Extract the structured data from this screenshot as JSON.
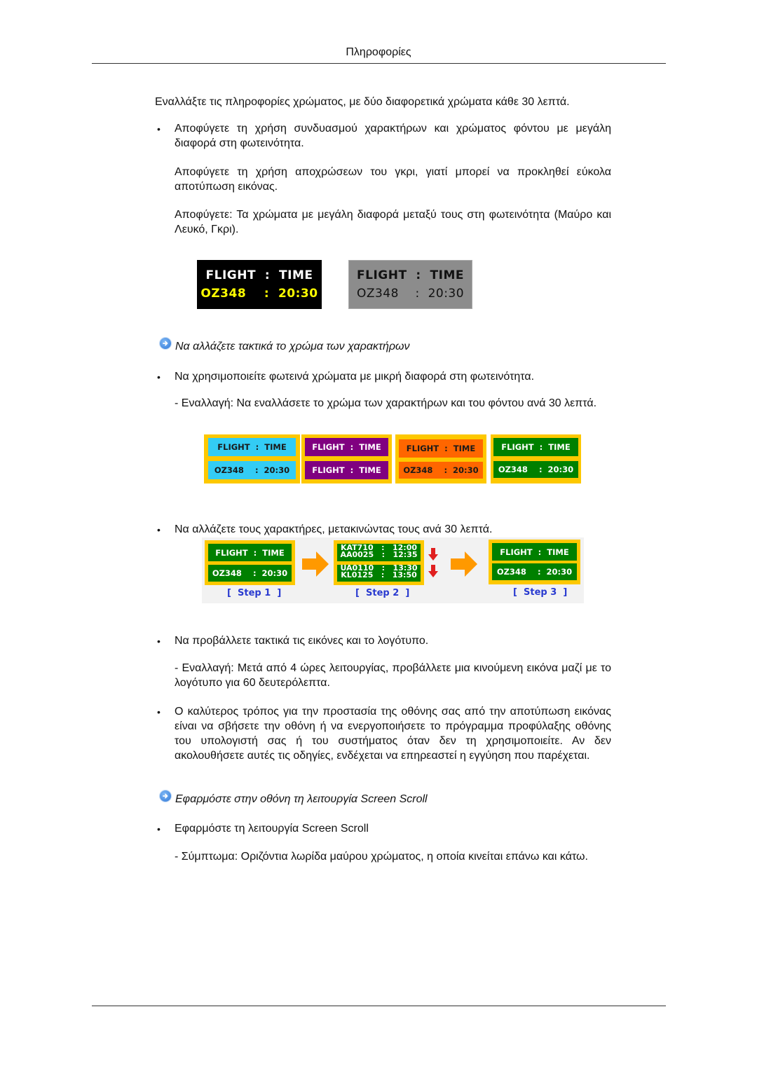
{
  "header": {
    "title": "Πληροφορίες"
  },
  "intro": "Εναλλάξτε τις πληροφορίες χρώματος, με δύο διαφορετικά χρώματα κάθε 30 λεπτά.",
  "section1": {
    "bullet": "Αποφύγετε τη χρήση συνδυασμού χαρακτήρων και χρώματος φόντου με μεγάλη διαφορά στη φωτεινότητα.",
    "para1": "Αποφύγετε τη χρήση αποχρώσεων του γκρι, γιατί μπορεί να προκληθεί εύκολα αποτύπωση εικόνας.",
    "para2": "Αποφύγετε: Τα χρώματα με μεγάλη διαφορά μεταξύ τους στη φωτεινότητα (Μαύρο και Λευκό, Γκρι).",
    "examples": [
      {
        "line1": "FLIGHT  :  TIME",
        "line2": "OZ348    :  20:30",
        "bg": "#000000",
        "color1": "#ffffff",
        "color2": "#ffff00"
      },
      {
        "line1": "FLIGHT  :  TIME",
        "line2": "OZ348    :  20:30",
        "bg": "#8c8c8c",
        "color1": "#111111",
        "color2": "#111111"
      }
    ]
  },
  "section2": {
    "heading": "Να αλλάζετε τακτικά το χρώμα των χαρακτήρων",
    "heading_icon": "arrow-right-circle-icon",
    "bullet": "Να χρησιμοποιείτε φωτεινά χρώματα με μικρή διαφορά στη φωτεινότητα.",
    "para": "- Εναλλαγή: Να εναλλάσετε το χρώμα των χαρακτήρων και του φόντου ανά 30 λεπτά.",
    "frame_color": "#fdc800",
    "panels": [
      {
        "top": "FLIGHT  :  TIME",
        "bottom": "OZ348    :  20:30",
        "bg": "#33ccf5",
        "color": "#1a1a1a"
      },
      {
        "top": "FLIGHT  :  TIME",
        "bottom": "FLIGHT  :  TIME",
        "bg": "#800080",
        "color": "#ffffff"
      },
      {
        "top": "FLIGHT  :  TIME",
        "bottom": "OZ348    :  20:30",
        "bg": "#ff6600",
        "color": "#1a1a1a"
      },
      {
        "top": "FLIGHT  :  TIME",
        "bottom": "OZ348    :  20:30",
        "bg": "#008000",
        "color": "#ffffff"
      }
    ]
  },
  "section3": {
    "bullet": "Να αλλάζετε τους χαρακτήρες, μετακινώντας τους ανά 30 λεπτά.",
    "steps": [
      {
        "label": "[  Step 1  ]",
        "top": "FLIGHT  :  TIME",
        "bottom": "OZ348    :  20:30"
      },
      {
        "label": "[  Step 2  ]",
        "top_a": "KAT710   :   12:00",
        "top_b": "AA0025   :   12:35",
        "bottom_a": "UA0110   :   13:30",
        "bottom_b": "KL0125   :   13:50"
      },
      {
        "label": "[  Step 3  ]",
        "top": "FLIGHT  :  TIME",
        "bottom": "OZ348    :  20:30"
      }
    ],
    "panel_bg": "#008000",
    "text_color": "#ffffff",
    "arrow_color": "#ff9900",
    "down_arrow_color": "#e02020",
    "step_label_color": "#2a3bd0"
  },
  "section4": {
    "bullet": "Να προβάλλετε τακτικά τις εικόνες και το λογότυπο.",
    "para": "- Εναλλαγή: Μετά από 4 ώρες λειτουργίας, προβάλλετε μια κινούμενη εικόνα μαζί με το λογότυπο για 60 δευτερόλεπτα."
  },
  "section5": {
    "bullet": "Ο καλύτερος τρόπος για την προστασία της οθόνης σας από την αποτύπωση εικόνας είναι να σβήσετε την οθόνη ή να ενεργοποιήσετε το πρόγραμμα προφύλαξης οθόνης του υπολογιστή σας ή του συστήματος όταν δεν τη χρησιμοποιείτε. Αν δεν ακολουθήσετε αυτές τις οδηγίες, ενδέχεται να επηρεαστεί η εγγύηση που παρέχεται."
  },
  "section6": {
    "heading": "Εφαρμόστε στην οθόνη τη λειτουργία Screen Scroll",
    "heading_icon": "arrow-right-circle-icon",
    "bullet": "Εφαρμόστε τη λειτουργία Screen Scroll",
    "para": "- Σύμπτωμα: Οριζόντια λωρίδα μαύρου χρώματος, η οποία κινείται επάνω και κάτω."
  },
  "bullet_char": "•"
}
